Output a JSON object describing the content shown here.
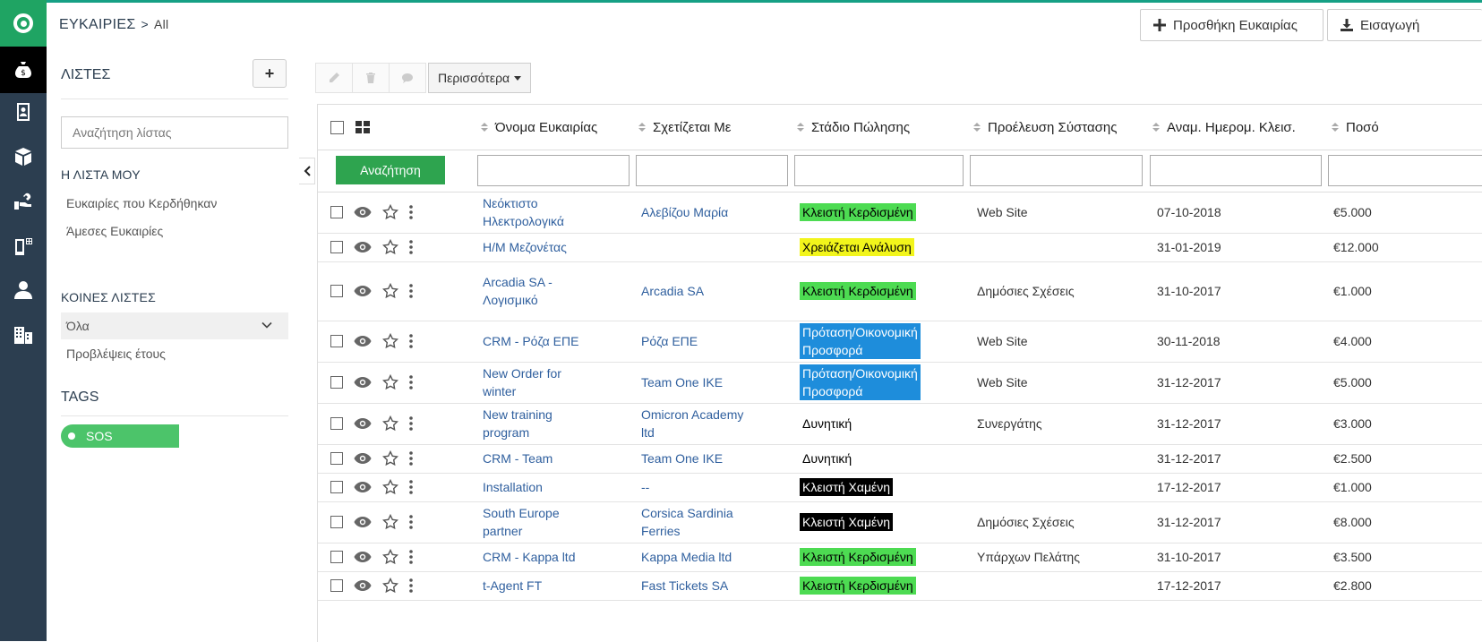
{
  "app": {
    "accent": "#16a085",
    "rail_bg": "#2c3e50",
    "logo_bg": "#1fa463"
  },
  "rail": {
    "items": [
      {
        "name": "money-bag-icon",
        "active": true
      },
      {
        "name": "contacts-icon",
        "active": false
      },
      {
        "name": "box-icon",
        "active": false
      },
      {
        "name": "tools-icon",
        "active": false
      },
      {
        "name": "mobile-grid-icon",
        "active": false
      },
      {
        "name": "user-icon",
        "active": false
      },
      {
        "name": "buildings-icon",
        "active": false
      }
    ]
  },
  "header": {
    "title": "ΕΥΚΑΙΡΙΕΣ",
    "breadcrumb_current": "All",
    "add_button": "Προσθήκη Ευκαιρίας",
    "import_button": "Εισαγωγή"
  },
  "sidebar": {
    "title": "ΛΙΣΤΕΣ",
    "add_label": "+",
    "search_placeholder": "Αναζήτηση λίστας",
    "my_list": {
      "title": "Η ΛΙΣΤΑ ΜΟΥ",
      "items": [
        "Ευκαιρίες που Κερδήθηκαν",
        "Άμεσες Ευκαιρίες"
      ]
    },
    "shared_lists": {
      "title": "ΚΟΙΝΕΣ ΛΙΣΤΕΣ",
      "items": [
        {
          "label": "Όλα",
          "selected": true
        },
        {
          "label": "Προβλέψεις έτους",
          "selected": false
        }
      ]
    },
    "tags": {
      "title": "TAGS",
      "items": [
        {
          "label": "SOS",
          "color": "#4cc46a"
        }
      ]
    }
  },
  "toolbar": {
    "more_label": "Περισσότερα"
  },
  "table": {
    "columns": [
      "Όνομα Ευκαιρίας",
      "Σχετίζεται Με",
      "Στάδιο Πώλησης",
      "Προέλευση Σύστασης",
      "Αναμ. Ημερομ. Κλεισ.",
      "Ποσό"
    ],
    "search_button": "Αναζήτηση",
    "stage_colors": {
      "Κλειστή Κερδισμένη": {
        "bg": "#4ddb52",
        "fg": "#000"
      },
      "Χρειάζεται Ανάλυση": {
        "bg": "#f2f51b",
        "fg": "#000"
      },
      "Πρόταση/Οικονομική Προσφορά": {
        "bg": "#1e8ddb",
        "fg": "#fff"
      },
      "Κλειστή Χαμένη": {
        "bg": "#000000",
        "fg": "#fff"
      },
      "Δυνητική": {
        "bg": "transparent",
        "fg": "#000"
      }
    },
    "rows": [
      {
        "name": [
          "Νεόκτιστο",
          "Ηλεκτρολογικά"
        ],
        "related": [
          "Αλεβίζου Μαρία"
        ],
        "stage": [
          "Κλειστή Κερδισμένη"
        ],
        "stage_key": "Κλειστή Κερδισμένη",
        "source": "Web Site",
        "date": "07-10-2018",
        "amount": "€5.000"
      },
      {
        "name": [
          "Η/Μ Μεζονέτας"
        ],
        "related": [],
        "stage": [
          "Χρειάζεται Ανάλυση"
        ],
        "stage_key": "Χρειάζεται Ανάλυση",
        "source": "",
        "date": "31-01-2019",
        "amount": "€12.000"
      },
      {
        "name": [
          "Arcadia SA -",
          "Λογισμικό"
        ],
        "related": [
          "Arcadia SA"
        ],
        "stage": [
          "Κλειστή Κερδισμένη"
        ],
        "stage_key": "Κλειστή Κερδισμένη",
        "source": "Δημόσιες Σχέσεις",
        "date": "31-10-2017",
        "amount": "€1.000"
      },
      {
        "name": [
          "CRM - Ρόζα ΕΠΕ"
        ],
        "related": [
          "Ρόζα ΕΠΕ"
        ],
        "stage": [
          "Πρόταση/Οικονομική",
          "Προσφορά"
        ],
        "stage_key": "Πρόταση/Οικονομική Προσφορά",
        "source": "Web Site",
        "date": "30-11-2018",
        "amount": "€4.000"
      },
      {
        "name": [
          "New Order for",
          "winter"
        ],
        "related": [
          "Team One IKE"
        ],
        "stage": [
          "Πρόταση/Οικονομική",
          "Προσφορά"
        ],
        "stage_key": "Πρόταση/Οικονομική Προσφορά",
        "source": "Web Site",
        "date": "31-12-2017",
        "amount": "€5.000"
      },
      {
        "name": [
          "New training",
          "program"
        ],
        "related": [
          "Omicron Academy",
          "ltd"
        ],
        "stage": [
          "Δυνητική"
        ],
        "stage_key": "Δυνητική",
        "source": "Συνεργάτης",
        "date": "31-12-2017",
        "amount": "€3.000"
      },
      {
        "name": [
          "CRM - Team"
        ],
        "related": [
          "Team One IKE"
        ],
        "stage": [
          "Δυνητική"
        ],
        "stage_key": "Δυνητική",
        "source": "",
        "date": "31-12-2017",
        "amount": "€2.500"
      },
      {
        "name": [
          "Installation"
        ],
        "related": [
          "--"
        ],
        "stage": [
          "Κλειστή Χαμένη"
        ],
        "stage_key": "Κλειστή Χαμένη",
        "source": "",
        "date": "17-12-2017",
        "amount": "€1.000"
      },
      {
        "name": [
          "South Europe",
          "partner"
        ],
        "related": [
          "Corsica Sardinia",
          "Ferries"
        ],
        "stage": [
          "Κλειστή Χαμένη"
        ],
        "stage_key": "Κλειστή Χαμένη",
        "source": "Δημόσιες Σχέσεις",
        "date": "31-12-2017",
        "amount": "€8.000"
      },
      {
        "name": [
          "CRM - Kappa ltd"
        ],
        "related": [
          "Kappa Media ltd"
        ],
        "stage": [
          "Κλειστή Κερδισμένη"
        ],
        "stage_key": "Κλειστή Κερδισμένη",
        "source": "Υπάρχων Πελάτης",
        "date": "31-10-2017",
        "amount": "€3.500"
      },
      {
        "name": [
          "t-Agent FT"
        ],
        "related": [
          "Fast Tickets SA"
        ],
        "stage": [
          "Κλειστή Κερδισμένη"
        ],
        "stage_key": "Κλειστή Κερδισμένη",
        "source": "",
        "date": "17-12-2017",
        "amount": "€2.800"
      }
    ]
  }
}
